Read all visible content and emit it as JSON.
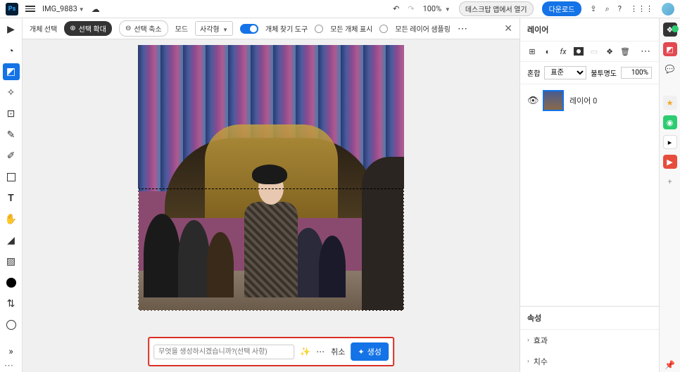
{
  "topbar": {
    "app": "Ps",
    "filename": "IMG_9883",
    "undo_icon": "undo",
    "redo_icon": "redo",
    "zoom": "100%",
    "desktop_open": "데스크탑 앱에서 열기",
    "download": "다운로드"
  },
  "options": {
    "object_select": "개체 선택",
    "expand_select": "선택 확대",
    "shrink_select": "선택 축소",
    "mode_label": "모드",
    "mode_value": "사각형",
    "object_finder": "개체 찾기 도구",
    "show_all": "모든 개체 표시",
    "sample_all": "모든 레이어 샘플링"
  },
  "prompt": {
    "placeholder": "무엇을 생성하시겠습니까?(선택 사항)",
    "cancel": "취소",
    "generate": "생성"
  },
  "layers": {
    "title": "레이어",
    "blend_label": "혼합",
    "blend_mode": "표준",
    "opacity_label": "불투명도",
    "opacity_value": "100%",
    "layer0_name": "레이어 0"
  },
  "props": {
    "title": "속성",
    "effects": "효과",
    "dimensions": "치수"
  }
}
